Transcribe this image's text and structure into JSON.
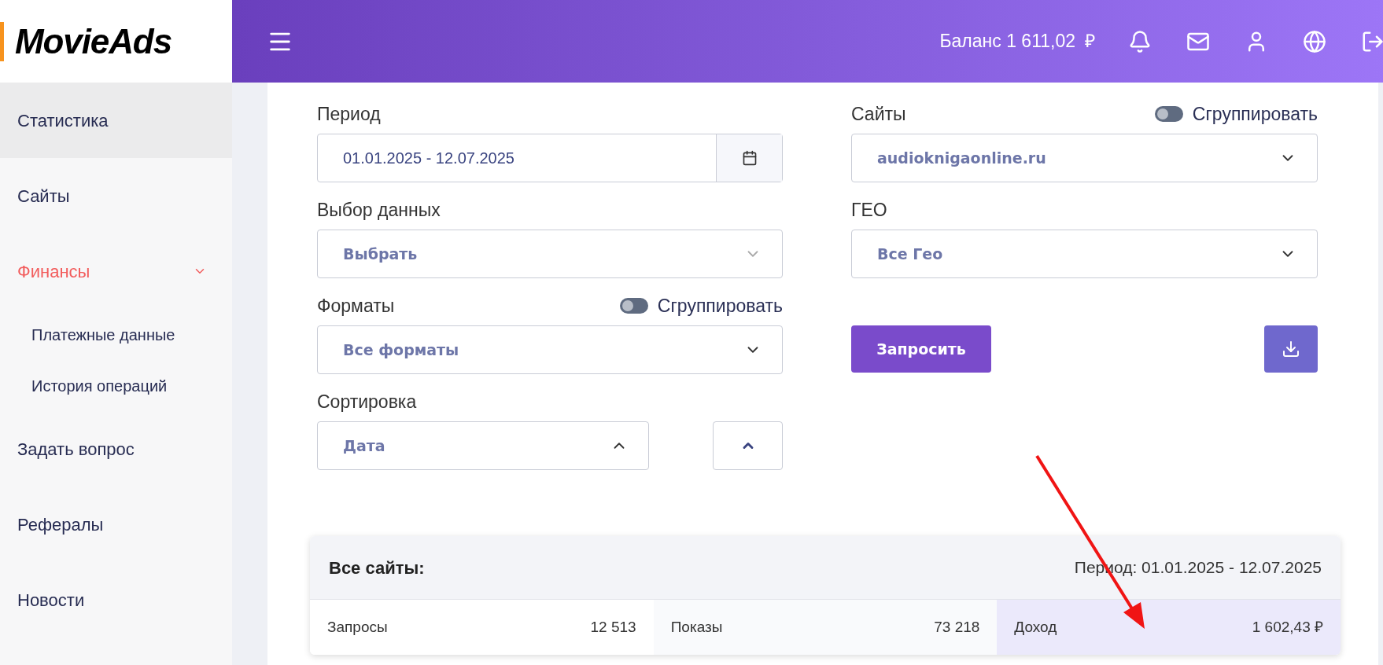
{
  "logo": "MovieAds",
  "sidebar": {
    "items": [
      {
        "label": "Статистика",
        "selected": true
      },
      {
        "label": "Сайты",
        "selected": false
      },
      {
        "label": "Финансы",
        "selected": false,
        "expanded": true,
        "children": [
          {
            "label": "Платежные данные",
            "selected": false
          },
          {
            "label": "История операций",
            "selected": false
          }
        ]
      },
      {
        "label": "Задать вопрос",
        "selected": false
      },
      {
        "label": "Рефералы",
        "selected": false
      },
      {
        "label": "Новости",
        "selected": false
      }
    ]
  },
  "topbar": {
    "balance": "Баланс 1 611,02",
    "currency": "₽"
  },
  "filters": {
    "period": {
      "label": "Период",
      "value": "01.01.2025 - 12.07.2025"
    },
    "data_choice": {
      "label": "Выбор данных",
      "placeholder": "Выбрать"
    },
    "formats": {
      "label": "Форматы",
      "toggle": {
        "label": "Сгруппировать",
        "on": false
      },
      "value": "Все форматы"
    },
    "sorting": {
      "label": "Сортировка",
      "value": "Дата",
      "expanded": true
    },
    "sites": {
      "label": "Сайты",
      "toggle": {
        "label": "Сгруппировать",
        "on": false
      },
      "value": "audioknigaonline.ru"
    },
    "geo": {
      "label": "ГЕО",
      "value": "Все Гео"
    },
    "submit": "Запросить"
  },
  "summary": {
    "title": "Все сайты:",
    "period": "Период: 01.01.2025 - 12.07.2025",
    "cells": [
      {
        "label": "Запросы",
        "value": "12 513",
        "highlighted": false
      },
      {
        "label": "Показы",
        "value": "73 218",
        "highlighted": false
      },
      {
        "label": "Доход",
        "value": "1 602,43 ₽",
        "highlighted": true
      }
    ]
  }
}
